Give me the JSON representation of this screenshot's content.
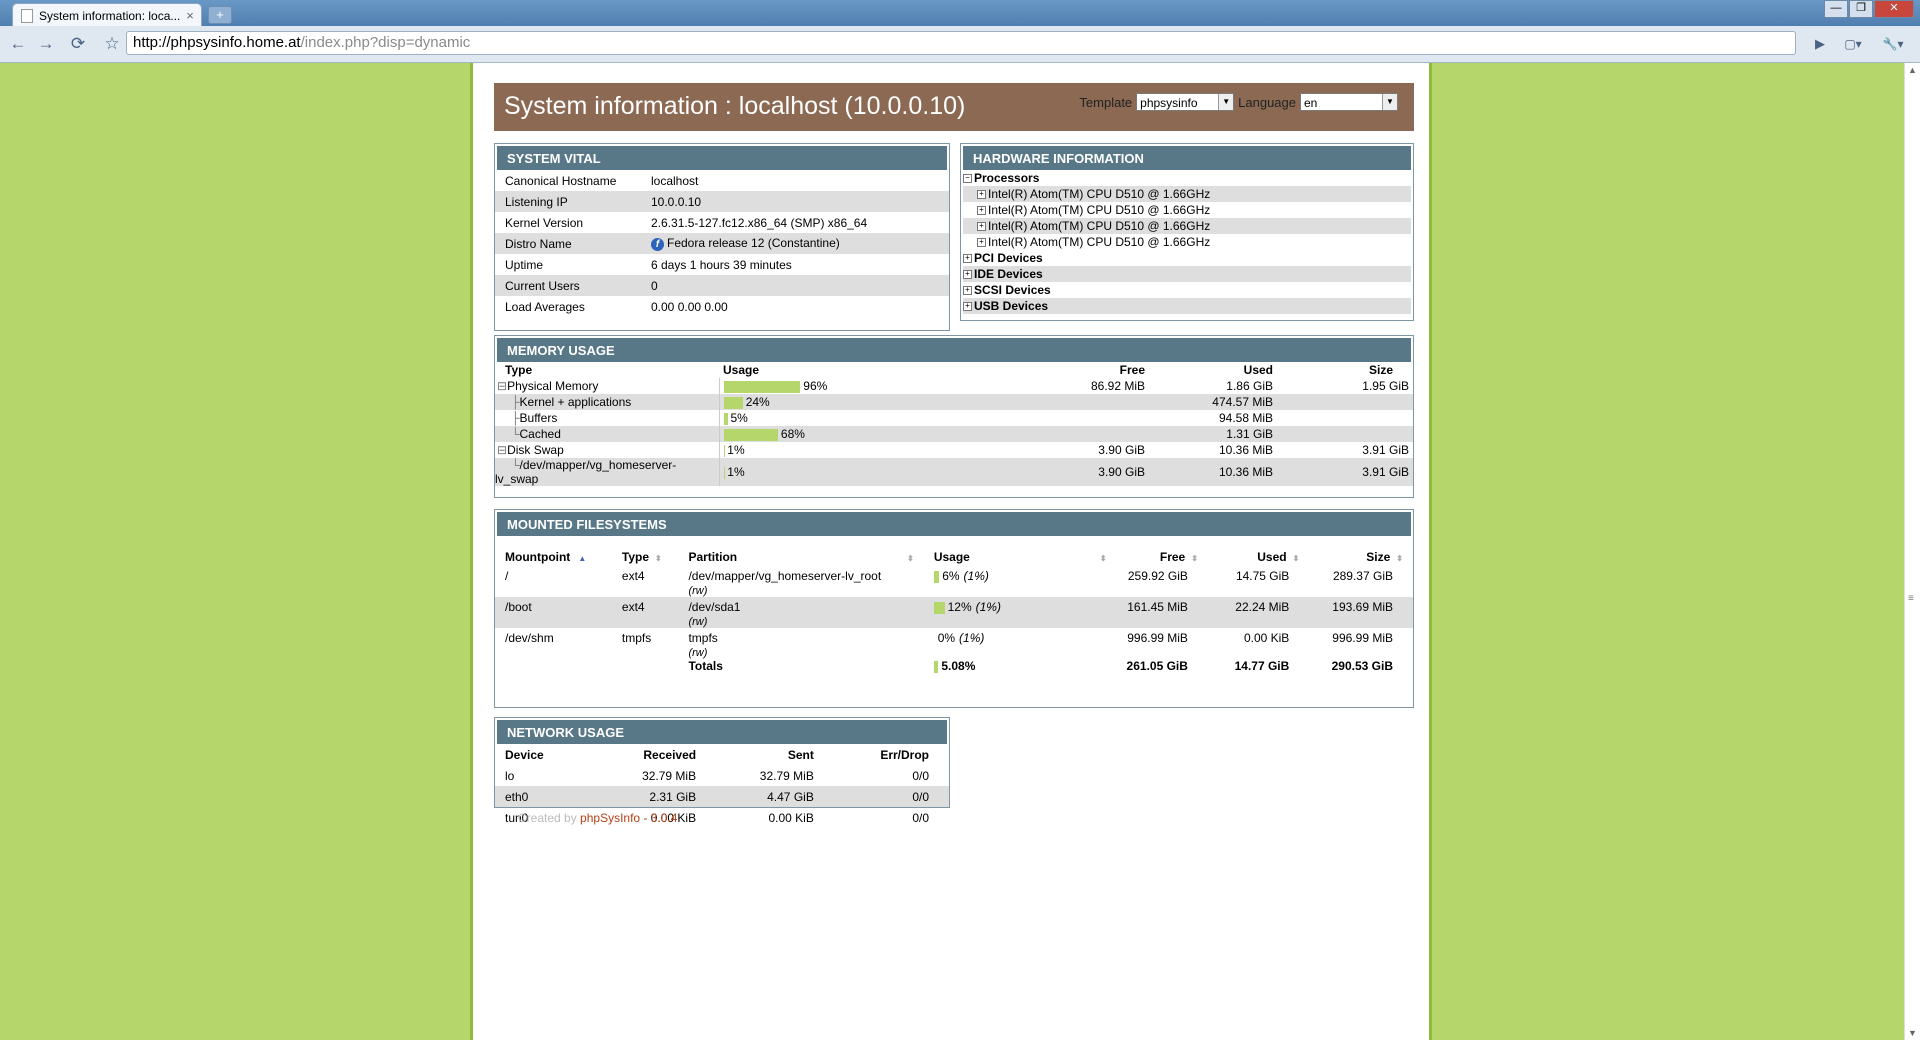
{
  "browser": {
    "tab_title": "System information: loca...",
    "tab_close": "×",
    "new_tab": "+",
    "url_host": "http://phpsysinfo.home.at",
    "url_path": "/index.php?disp=dynamic",
    "window_buttons": {
      "minimize": "—",
      "maximize": "❐",
      "close": "✕"
    },
    "toolbar_icons": {
      "back": "←",
      "forward": "→",
      "reload": "⟳",
      "star": "☆",
      "play": "▶",
      "page": "▢▾",
      "tools": "🔧▾"
    }
  },
  "header": {
    "title": "System information : localhost (10.0.0.10)",
    "template_label": "Template",
    "template_value": "phpsysinfo",
    "language_label": "Language",
    "language_value": "en"
  },
  "vital": {
    "title": "SYSTEM VITAL",
    "rows": [
      {
        "label": "Canonical Hostname",
        "value": "localhost"
      },
      {
        "label": "Listening IP",
        "value": "10.0.0.10"
      },
      {
        "label": "Kernel Version",
        "value": "2.6.31.5-127.fc12.x86_64 (SMP) x86_64"
      },
      {
        "label": "Distro Name",
        "value": "Fedora release 12 (Constantine)"
      },
      {
        "label": "Uptime",
        "value": "6 days 1 hours 39 minutes"
      },
      {
        "label": "Current Users",
        "value": "0"
      },
      {
        "label": "Load Averages",
        "value": "0.00 0.00 0.00"
      }
    ]
  },
  "hardware": {
    "title": "HARDWARE INFORMATION",
    "processors_label": "Processors",
    "cpus": [
      "Intel(R) Atom(TM) CPU D510 @ 1.66GHz",
      "Intel(R) Atom(TM) CPU D510 @ 1.66GHz",
      "Intel(R) Atom(TM) CPU D510 @ 1.66GHz",
      "Intel(R) Atom(TM) CPU D510 @ 1.66GHz"
    ],
    "groups": [
      "PCI Devices",
      "IDE Devices",
      "SCSI Devices",
      "USB Devices"
    ]
  },
  "memory": {
    "title": "MEMORY USAGE",
    "headers": {
      "type": "Type",
      "usage": "Usage",
      "free": "Free",
      "used": "Used",
      "size": "Size"
    },
    "rows": [
      {
        "type": "Physical Memory",
        "pct": 96,
        "pct_label": "96%",
        "free": "86.92 MiB",
        "used": "1.86 GiB",
        "size": "1.95 GiB"
      },
      {
        "type": "Kernel + applications",
        "pct": 24,
        "pct_label": "24%",
        "free": "",
        "used": "474.57 MiB",
        "size": ""
      },
      {
        "type": "Buffers",
        "pct": 5,
        "pct_label": "5%",
        "free": "",
        "used": "94.58 MiB",
        "size": ""
      },
      {
        "type": "Cached",
        "pct": 68,
        "pct_label": "68%",
        "free": "",
        "used": "1.31 GiB",
        "size": ""
      },
      {
        "type": "Disk Swap",
        "pct": 1,
        "pct_label": "1%",
        "free": "3.90 GiB",
        "used": "10.36 MiB",
        "size": "3.91 GiB"
      },
      {
        "type": "/dev/mapper/vg_homeserver-",
        "type2": "lv_swap",
        "pct": 1,
        "pct_label": "1%",
        "free": "3.90 GiB",
        "used": "10.36 MiB",
        "size": "3.91 GiB"
      }
    ]
  },
  "filesystems": {
    "title": "MOUNTED FILESYSTEMS",
    "headers": {
      "mount": "Mountpoint",
      "type": "Type",
      "partition": "Partition",
      "usage": "Usage",
      "free": "Free",
      "used": "Used",
      "size": "Size"
    },
    "rows": [
      {
        "mount": "/",
        "type": "ext4",
        "partition": "/dev/mapper/vg_homeserver-lv_root",
        "opts": "(rw)",
        "pct": 6,
        "usage": "6%",
        "inodes": "(1%)",
        "free": "259.92 GiB",
        "used": "14.75 GiB",
        "size": "289.37 GiB"
      },
      {
        "mount": "/boot",
        "type": "ext4",
        "partition": "/dev/sda1",
        "opts": "(rw)",
        "pct": 12,
        "usage": "12%",
        "inodes": "(1%)",
        "free": "161.45 MiB",
        "used": "22.24 MiB",
        "size": "193.69 MiB"
      },
      {
        "mount": "/dev/shm",
        "type": "tmpfs",
        "partition": "tmpfs",
        "opts": "(rw)",
        "pct": 0,
        "usage": "0%",
        "inodes": "(1%)",
        "free": "996.99 MiB",
        "used": "0.00 KiB",
        "size": "996.99 MiB"
      }
    ],
    "totals": {
      "label": "Totals",
      "pct": 5.08,
      "usage": "5.08%",
      "free": "261.05 GiB",
      "used": "14.77 GiB",
      "size": "290.53 GiB"
    }
  },
  "network": {
    "title": "NETWORK USAGE",
    "headers": {
      "device": "Device",
      "received": "Received",
      "sent": "Sent",
      "err": "Err/Drop"
    },
    "rows": [
      {
        "device": "lo",
        "received": "32.79 MiB",
        "sent": "32.79 MiB",
        "err": "0/0"
      },
      {
        "device": "eth0",
        "received": "2.31 GiB",
        "sent": "4.47 GiB",
        "err": "0/0"
      },
      {
        "device": "tun0",
        "received": "0.00 KiB",
        "sent": "0.00 KiB",
        "err": "0/0"
      }
    ]
  },
  "footer": {
    "prefix": "Created by",
    "link": "phpSysInfo",
    "version": "- 3.0.4"
  },
  "colors": {
    "background": "#b5d66a",
    "header": "#8b6952",
    "box_title": "#587787",
    "bar": "#b5d66a",
    "link": "#b83f15"
  }
}
